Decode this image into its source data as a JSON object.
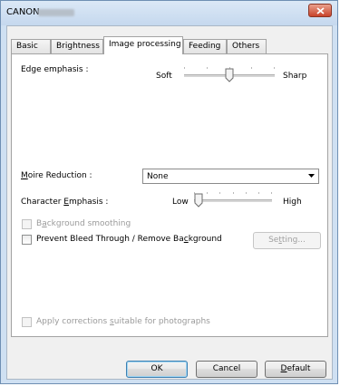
{
  "window": {
    "title": "CANON"
  },
  "tabs": [
    {
      "label": "Basic"
    },
    {
      "label": "Brightness"
    },
    {
      "label": "Image processing"
    },
    {
      "label": "Feeding"
    },
    {
      "label": "Others"
    }
  ],
  "edge_emphasis": {
    "label": "Edge emphasis :",
    "low_label": "Soft",
    "high_label": "Sharp",
    "level": 0.5
  },
  "moire_reduction": {
    "label_pre": "",
    "label_underline": "M",
    "label_post": "oire Reduction :",
    "selected": "None"
  },
  "character_emphasis": {
    "label_pre": "Character ",
    "label_underline": "E",
    "label_post": "mphasis :",
    "low_label": "Low",
    "high_label": "High",
    "level": 0.0
  },
  "background_smoothing": {
    "label_pre": "B",
    "label_underline": "a",
    "label_post": "ckground smoothing",
    "checked": false,
    "enabled": false
  },
  "prevent_bleed": {
    "label_pre": "Prevent Bleed Through / Remove Ba",
    "label_underline": "c",
    "label_post": "kground",
    "checked": false,
    "enabled": true
  },
  "setting_button": {
    "label_pre": "Se",
    "label_underline": "t",
    "label_post": "ting...",
    "enabled": false
  },
  "apply_photo": {
    "label_pre": "Apply corrections ",
    "label_underline": "s",
    "label_post": "uitable for photographs",
    "checked": false,
    "enabled": false
  },
  "footer": {
    "ok_label": "OK",
    "cancel_label": "Cancel",
    "default_label_underline": "D",
    "default_label_post": "efault"
  }
}
